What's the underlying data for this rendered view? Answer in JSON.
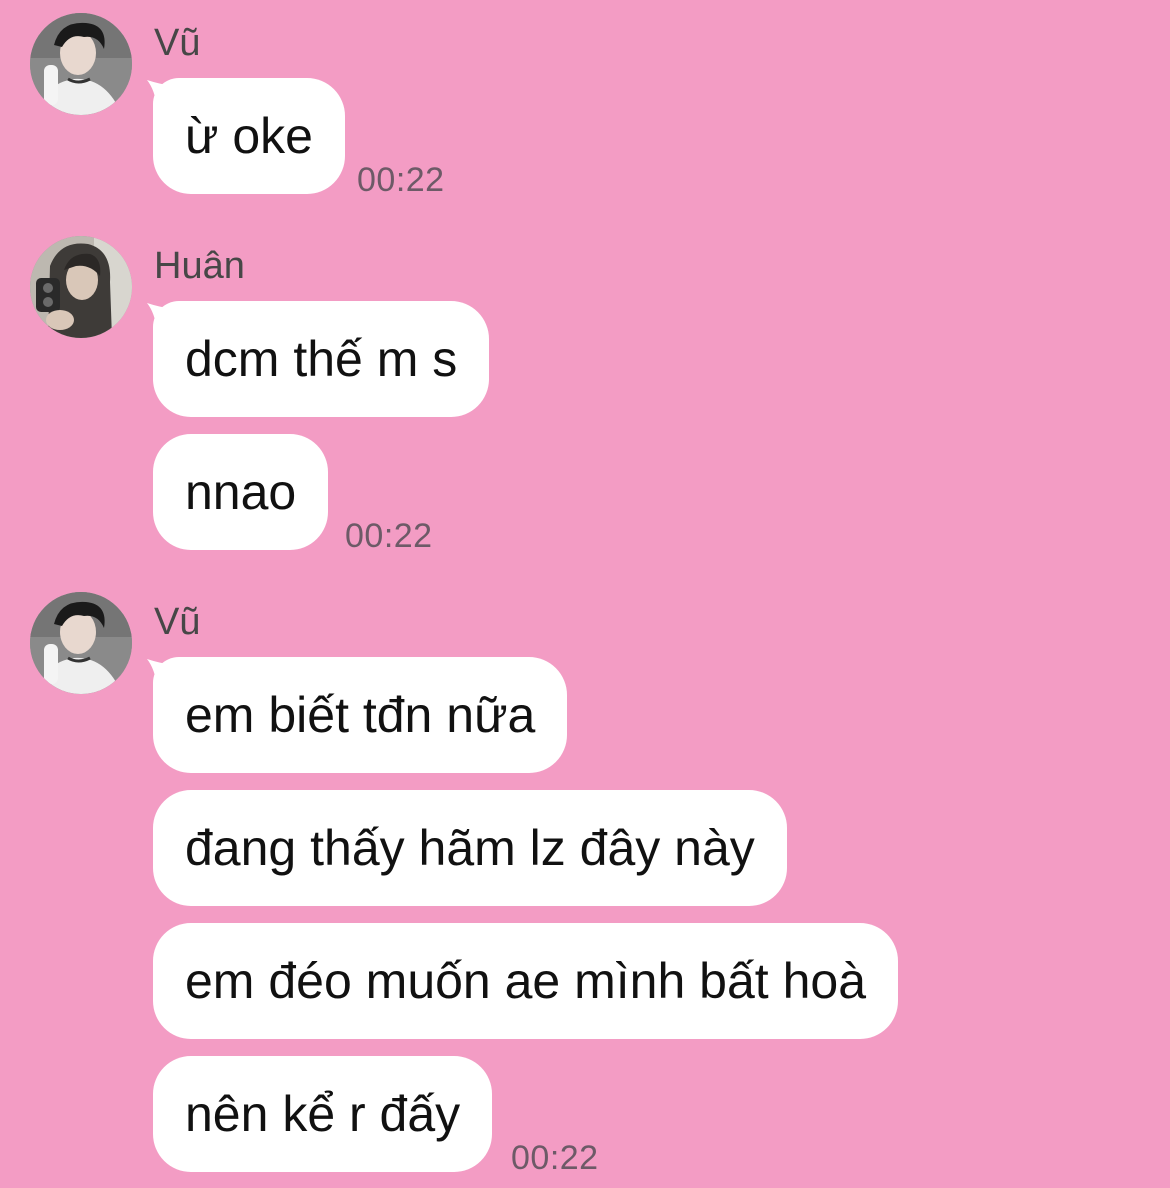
{
  "conversation": {
    "groups": [
      {
        "sender": "Vũ",
        "messages": [
          "ừ oke"
        ],
        "time": "00:22"
      },
      {
        "sender": "Huân",
        "messages": [
          "dcm thế m s",
          "nnao"
        ],
        "time": "00:22"
      },
      {
        "sender": "Vũ",
        "messages": [
          "em biết tđn nữa",
          "đang thấy hãm lz đây này",
          "em đéo muốn ae mình bất hoà",
          "nên kể r đấy"
        ],
        "time": "00:22"
      }
    ]
  },
  "avatars": {
    "vu": "avatar-vu",
    "huan": "avatar-huan"
  },
  "colors": {
    "background": "#f39cc4",
    "bubble": "#ffffff",
    "sender_name": "#474747",
    "timestamp": "#6d5a67"
  }
}
